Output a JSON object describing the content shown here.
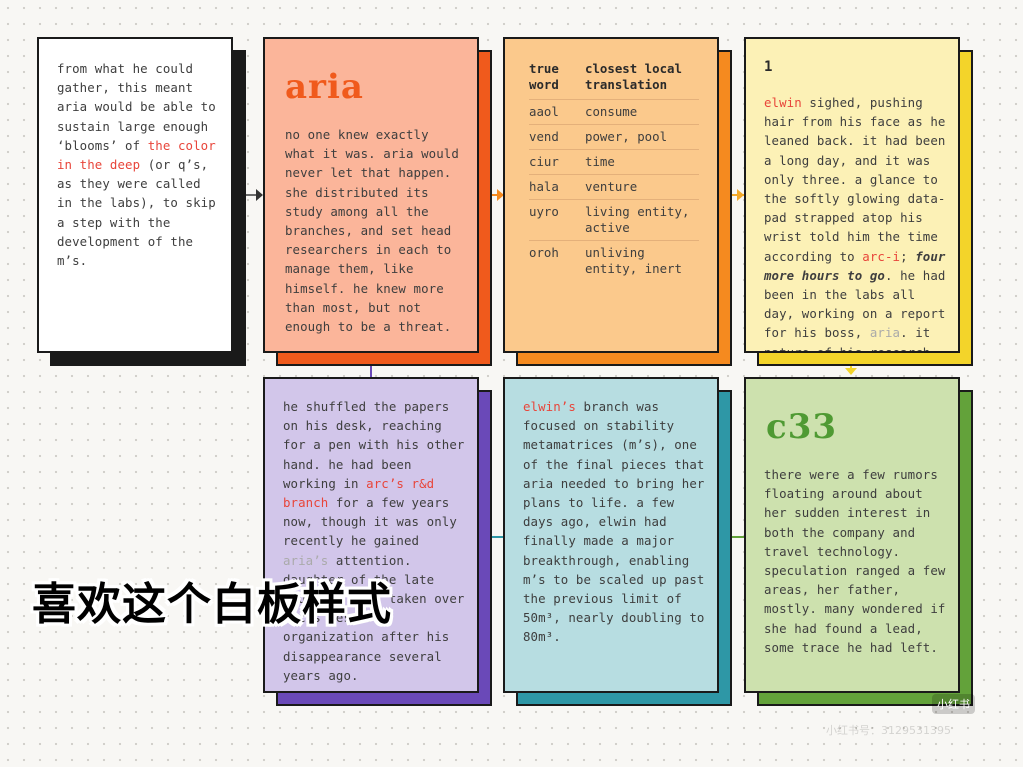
{
  "card1": {
    "text_a": "from what he could gather, this meant aria would be able to sustain large enough ‘blooms’ of ",
    "text_hl": "the color in the deep",
    "text_b": " (or q’s, as they were called in the labs), to skip a step with the development of the m’s."
  },
  "card2": {
    "title": "aria",
    "body": "no one knew exactly what it was. aria would never let that happen. she distributed its study among all the branches, and set head researchers in each to manage them, like himself. he knew more than most, but not enough to be a threat."
  },
  "card3": {
    "header_word": "true word",
    "header_translation": "closest local translation",
    "rows": [
      {
        "word": "aaol",
        "translation": "consume"
      },
      {
        "word": "vend",
        "translation": "power, pool"
      },
      {
        "word": "ciur",
        "translation": "time"
      },
      {
        "word": "hala",
        "translation": "venture"
      },
      {
        "word": "uyro",
        "translation": "living entity, active"
      },
      {
        "word": "oroh",
        "translation": "unliving entity, inert"
      }
    ]
  },
  "card4": {
    "number": "1",
    "name": "elwin",
    "t1": " sighed, pushing hair from his face as he leaned back. it had been a long day, and it was only three. a glance to the softly glowing data-pad strapped atop his wrist told him the time according to ",
    "arc": "arc-i",
    "t2": "; ",
    "italic": "four more hours to go",
    "t3": ". he had been in the labs all day, working on a report for his boss, ",
    "aria": "aria",
    "t4": ". it nature of his research"
  },
  "card5": {
    "t1": "he shuffled the papers on his desk, reaching for a pen with his other hand. he had been working in ",
    "hl": "arc’s r&d branch",
    "t2": " for a few years now, though it was only recently he gained ",
    "faint": "aria’s",
    "t3": " attention. daughter of the late founder, jack ",
    "t4": "taken over arc’s research organization after his disappearance several years ago."
  },
  "card6": {
    "hl": "elwin’s",
    "t1": " branch was focused on stability metamatrices (m’s), one of the final pieces that aria needed to bring her plans to life. a few days ago, elwin had finally made a major breakthrough, enabling m’s to be scaled up past the previous limit of 50m³, nearly doubling to 80m³."
  },
  "card7": {
    "title": "c33",
    "body": "there were a few rumors floating around about her sudden interest in both the company and travel technology. speculation ranged a few areas, her father, mostly. many wondered if she had found a lead, some trace he had left."
  },
  "overlay": {
    "caption": "喜欢这个白板样式",
    "watermark_logo": "小红书",
    "watermark_id": "小红书号：3129531395"
  },
  "colors": {
    "card1": "#ffffff",
    "card1_shadow": "#1a1a1a",
    "card2": "#fbb59a",
    "card2_shadow": "#f05a1c",
    "card3": "#fbc98c",
    "card3_shadow": "#f58a1f",
    "card4": "#fcf1b6",
    "card4_shadow": "#f3d42a",
    "card5": "#d2c6ea",
    "card5_shadow": "#6a49b8",
    "card6": "#b7dde1",
    "card6_shadow": "#2e97a6",
    "card7": "#cde1ae",
    "card7_shadow": "#63a23a",
    "highlight": "#e8453a"
  }
}
